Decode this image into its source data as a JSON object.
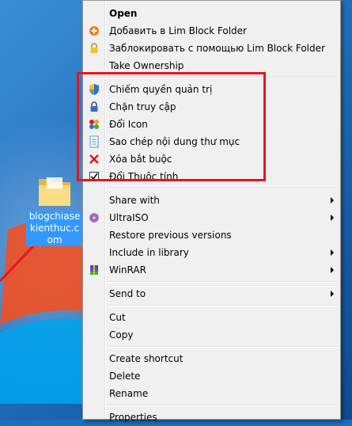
{
  "desktop": {
    "icon": {
      "label": "blogchiasekienthuc.com"
    }
  },
  "context_menu": {
    "groups": [
      [
        {
          "label": "Open",
          "icon": "none",
          "bold": true
        },
        {
          "label": "Добавить в Lim Block Folder",
          "icon": "orange-plus-icon"
        },
        {
          "label": "Заблокировать с помощью Lim Block Folder",
          "icon": "lock-icon"
        },
        {
          "label": "Take Ownership",
          "icon": "none"
        }
      ],
      [
        {
          "label": "Chiếm quyền quản trị",
          "icon": "uac-shield-icon"
        },
        {
          "label": "Chặn truy cập",
          "icon": "padlock-icon"
        },
        {
          "label": "Đổi Icon",
          "icon": "colorful-icon"
        },
        {
          "label": "Sao chép nội dung thư mục",
          "icon": "document-icon"
        },
        {
          "label": "Xóa bắt buộc",
          "icon": "red-x-icon"
        },
        {
          "label": "Đổi Thuộc tính",
          "icon": "checkbox-icon"
        }
      ],
      [
        {
          "label": "Share with",
          "icon": "none",
          "submenu": true
        },
        {
          "label": "UltraISO",
          "icon": "ultraiso-icon",
          "submenu": true
        },
        {
          "label": "Restore previous versions",
          "icon": "none"
        },
        {
          "label": "Include in library",
          "icon": "none",
          "submenu": true
        },
        {
          "label": "WinRAR",
          "icon": "winrar-icon",
          "submenu": true
        }
      ],
      [
        {
          "label": "Send to",
          "icon": "none",
          "submenu": true
        }
      ],
      [
        {
          "label": "Cut",
          "icon": "none"
        },
        {
          "label": "Copy",
          "icon": "none"
        }
      ],
      [
        {
          "label": "Create shortcut",
          "icon": "none"
        },
        {
          "label": "Delete",
          "icon": "none"
        },
        {
          "label": "Rename",
          "icon": "none"
        }
      ],
      [
        {
          "label": "Properties",
          "icon": "none"
        }
      ]
    ]
  },
  "colors": {
    "highlight_box": "#e8141b",
    "menu_background": "#f0f0f0",
    "selection_label": "#3399ff"
  }
}
